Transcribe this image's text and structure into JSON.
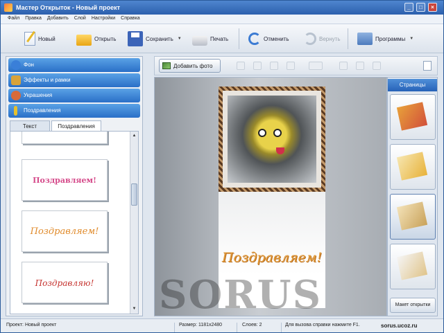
{
  "window": {
    "title": "Мастер Открыток - Новый проект",
    "controls": [
      "_",
      "□",
      "×"
    ]
  },
  "menu": {
    "items": [
      "Файл",
      "Правка",
      "Добавить",
      "Слой",
      "Настройки",
      "Справка"
    ]
  },
  "toolbar": {
    "new_label": "Новый",
    "open_label": "Открыть",
    "save_label": "Сохранить",
    "print_label": "Печать",
    "undo_label": "Отменить",
    "redo_label": "Вернуть",
    "programs_label": "Программы",
    "dropdown_arrow": "▼"
  },
  "categories": [
    {
      "label": "Фон",
      "icon": "globe-icon",
      "color": "#3a7fd8"
    },
    {
      "label": "Эффекты и рамки",
      "icon": "effects-icon",
      "color": "#d8a33a"
    },
    {
      "label": "Украшения",
      "icon": "decorations-icon",
      "color": "#d86a3a"
    },
    {
      "label": "Поздравления",
      "icon": "exclamation-icon",
      "color": "#e6c02e"
    }
  ],
  "tabs": {
    "text": "Текст",
    "greetings": "Поздравления"
  },
  "thumbnails": [
    {
      "text": "",
      "style": "blank"
    },
    {
      "text": "Поздравляем!",
      "style": "pink"
    },
    {
      "text": "Поздравляем!",
      "style": "orange"
    },
    {
      "text": "Поздравляю!",
      "style": "red"
    }
  ],
  "scrollbar": {
    "up": "▲",
    "down": "▼"
  },
  "workbar": {
    "add_photo_label": "Добавить фото"
  },
  "card": {
    "greeting": "Поздравляем!"
  },
  "pages": {
    "title": "Страницы",
    "layout_button": "Макет открытки"
  },
  "watermark": {
    "text": "SORUS"
  },
  "status": {
    "project": "Проект: Новый проект",
    "size": "Размер: 1181x2480",
    "layers": "Слоев: 2",
    "help": "Для вызова справки нажмите F1.",
    "site": "sorus.ucoz.ru"
  },
  "colors": {
    "accent": "#2c6fc7",
    "title_bar": "#3b72c0"
  }
}
